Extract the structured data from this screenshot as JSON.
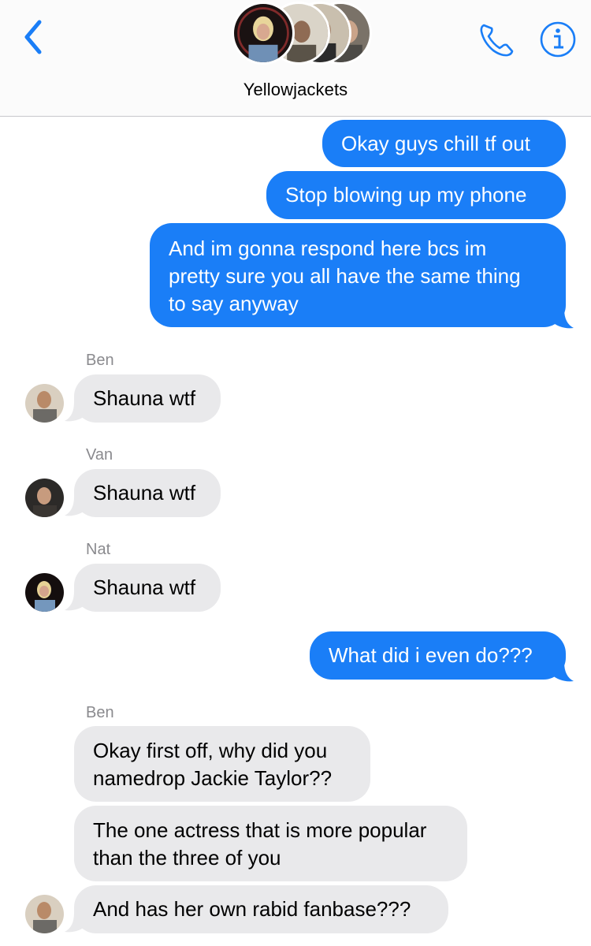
{
  "header": {
    "title": "Yellowjackets",
    "back_icon": "chevron-left-icon",
    "call_icon": "phone-icon",
    "info_icon": "info-icon",
    "accent": "#1a7ef7"
  },
  "messages": [
    {
      "sender": "me",
      "text": "Okay guys chill tf out"
    },
    {
      "sender": "me",
      "text": "Stop blowing up my phone"
    },
    {
      "sender": "me",
      "lines": [
        "And im gonna respond here bcs im",
        "pretty sure you all have the same thing",
        "to say anyway"
      ]
    },
    {
      "sender": "Ben",
      "text": "Shauna wtf"
    },
    {
      "sender": "Van",
      "text": "Shauna wtf"
    },
    {
      "sender": "Nat",
      "text": "Shauna wtf"
    },
    {
      "sender": "me",
      "text": "What did i even do???"
    },
    {
      "sender": "Ben",
      "lines": [
        "Okay first off, why did you",
        "namedrop Jackie Taylor??"
      ]
    },
    {
      "sender": "Ben",
      "lines": [
        "The one actress that is more popular",
        "than the three of you"
      ]
    },
    {
      "sender": "Ben",
      "text": "And has her own rabid fanbase???"
    }
  ],
  "colors": {
    "outgoing_bubble": "#1a7ef7",
    "incoming_bubble": "#e9e9eb",
    "sender_label": "#8a8a8e"
  }
}
